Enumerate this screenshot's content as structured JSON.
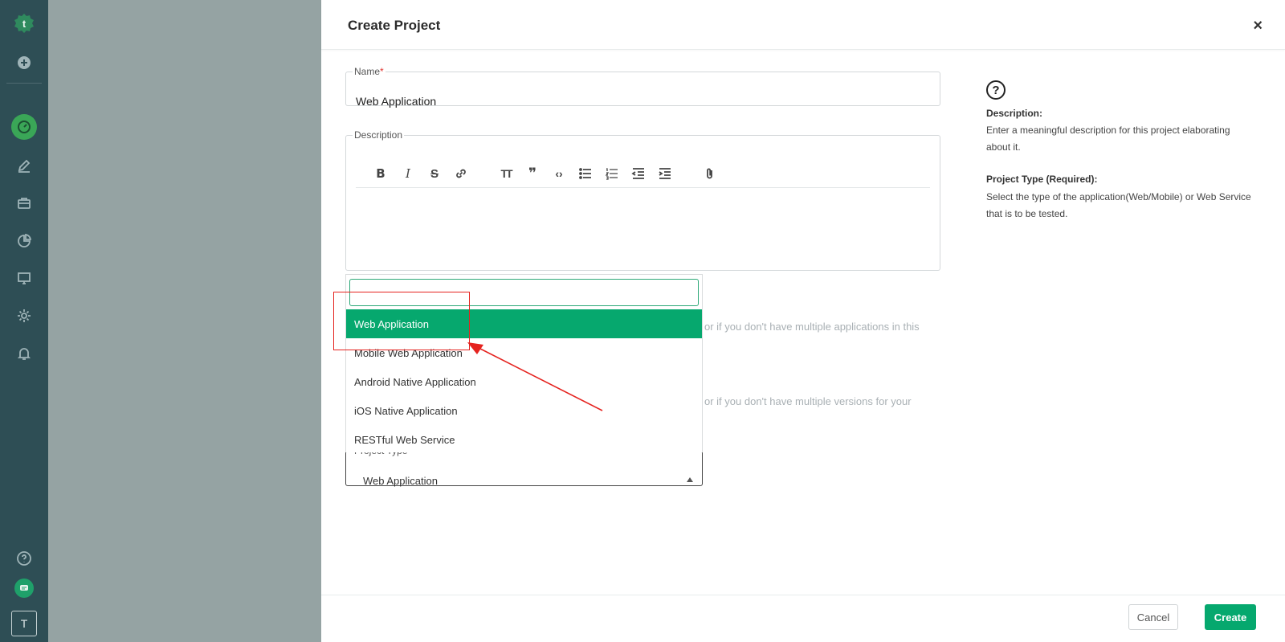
{
  "sidebar": {
    "items": [
      {
        "icon": "logo-icon"
      },
      {
        "icon": "plus-circle-icon"
      },
      {
        "icon": "dashboard-icon"
      },
      {
        "icon": "pencil-icon"
      },
      {
        "icon": "briefcase-icon"
      },
      {
        "icon": "pie-chart-icon"
      },
      {
        "icon": "monitor-icon"
      },
      {
        "icon": "gear-icon"
      },
      {
        "icon": "bell-icon"
      },
      {
        "icon": "help-circle-icon"
      },
      {
        "icon": "chat-icon"
      }
    ],
    "avatar_letter": "T"
  },
  "dialog": {
    "title": "Create Project",
    "close_symbol": "×"
  },
  "form": {
    "name_label": "Name",
    "name_required_mark": "*",
    "name_value": "Web Application",
    "description_label": "Description",
    "toolbar": [
      {
        "icon": "bold-icon",
        "glyph": "B"
      },
      {
        "icon": "italic-icon",
        "glyph": "I"
      },
      {
        "icon": "strikethrough-icon",
        "glyph": "S"
      },
      {
        "icon": "link-icon",
        "glyph": ""
      },
      {
        "icon": "heading-icon",
        "glyph": "TT"
      },
      {
        "icon": "quote-icon",
        "glyph": "❞"
      },
      {
        "icon": "code-icon",
        "glyph": "‹›"
      },
      {
        "icon": "bullet-list-icon",
        "glyph": ""
      },
      {
        "icon": "numbered-list-icon",
        "glyph": ""
      },
      {
        "icon": "outdent-icon",
        "glyph": ""
      },
      {
        "icon": "indent-icon",
        "glyph": ""
      },
      {
        "icon": "attachment-icon",
        "glyph": ""
      }
    ],
    "faded_text_1": "or if you don't have multiple applications in this",
    "faded_text_2": "or if you don't have multiple versions for your",
    "project_type_label": "Project Type",
    "project_type_value": "Web Application",
    "dropdown": {
      "search_value": "",
      "options": [
        "Web Application",
        "Mobile Web Application",
        "Android Native Application",
        "iOS Native Application",
        "RESTful Web Service"
      ],
      "selected_index": 0
    }
  },
  "help": {
    "icon_glyph": "?",
    "description_title": "Description:",
    "description_text": "Enter a meaningful description for this project elaborating about it.",
    "project_type_title": "Project Type (Required):",
    "project_type_text": "Select the type of the application(Web/Mobile) or Web Service that is to be tested."
  },
  "footer": {
    "cancel_label": "Cancel",
    "create_label": "Create"
  },
  "colors": {
    "sidebar_bg": "#2e4e55",
    "overlay_bg": "#95a3a3",
    "accent_green": "#06a86e",
    "annotation_red": "#e5231f"
  }
}
